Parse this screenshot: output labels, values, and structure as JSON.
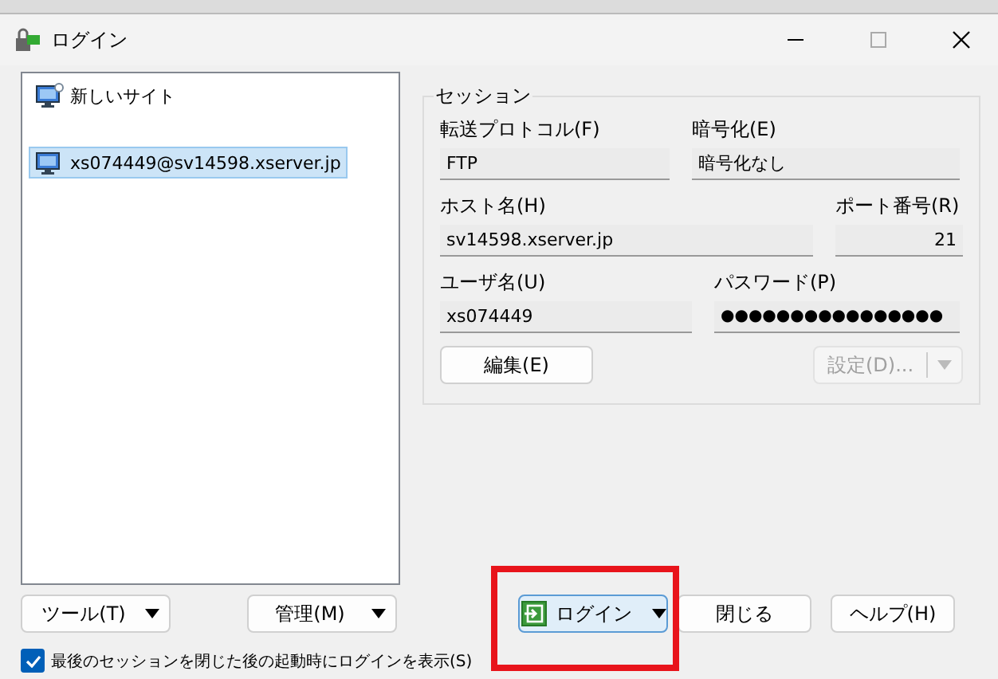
{
  "window": {
    "title": "ログイン"
  },
  "site_tree": {
    "items": [
      {
        "label": "新しいサイト",
        "kind": "new",
        "selected": false
      },
      {
        "label": "xs074449@sv14598.xserver.jp",
        "kind": "site",
        "selected": true
      }
    ]
  },
  "session": {
    "title": "セッション",
    "rows": [
      [
        {
          "label": "転送プロトコル(F)",
          "value": "FTP",
          "kind": "text"
        },
        {
          "label": "暗号化(E)",
          "value": "暗号化なし",
          "kind": "text"
        }
      ],
      [
        {
          "label": "ホスト名(H)",
          "value": "sv14598.xserver.jp",
          "kind": "text"
        },
        {
          "label": "ポート番号(R)",
          "value": "21",
          "kind": "number"
        }
      ],
      [
        {
          "label": "ユーザ名(U)",
          "value": "xs074449",
          "kind": "text"
        },
        {
          "label": "パスワード(P)",
          "value": "●●●●●●●●●●●●●●●●",
          "kind": "password"
        }
      ]
    ],
    "edit_button": {
      "label": "編集(E)",
      "disabled": false
    },
    "settings_button": {
      "label": "設定(D)...",
      "disabled": true
    }
  },
  "left_buttons": [
    {
      "label": "ツール(T)"
    },
    {
      "label": "管理(M)"
    }
  ],
  "action_buttons": [
    {
      "label": "ログイン",
      "kind": "split",
      "focused": true,
      "highlighted": true
    },
    {
      "label": "閉じる",
      "kind": "plain",
      "focused": false,
      "highlighted": false
    },
    {
      "label": "ヘルプ(H)",
      "kind": "plain",
      "focused": false,
      "highlighted": false
    }
  ],
  "startup_checkbox": {
    "label": "最後のセッションを閉じた後の起動時にログインを表示(S)",
    "checked": true
  }
}
